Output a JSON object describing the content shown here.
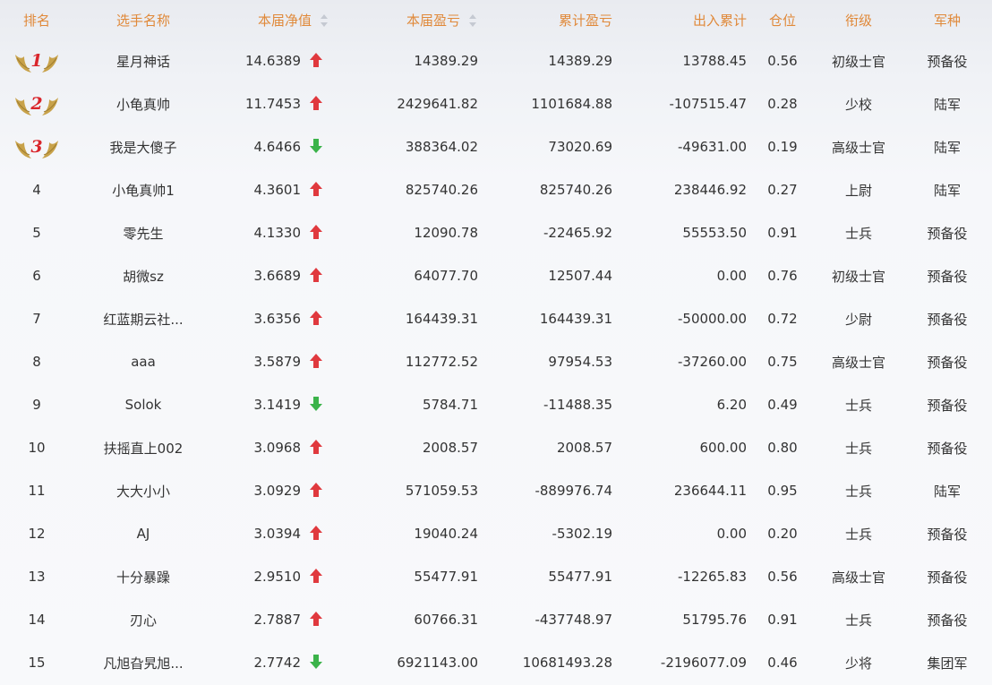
{
  "headers": {
    "rank": "排名",
    "name": "选手名称",
    "net": "本届净值",
    "current_pnl": "本届盈亏",
    "total_pnl": "累计盈亏",
    "inout": "出入累计",
    "position": "仓位",
    "grade": "衔级",
    "arm": "军种"
  },
  "colors": {
    "header": "#e0893a",
    "up": "#e0393e",
    "down": "#3bb34a",
    "medal": "#c8a24a",
    "medal_num": "#d9252b"
  },
  "rows": [
    {
      "rank": "1",
      "medal": true,
      "name": "星月神话",
      "net": "14.6389",
      "trend": "up",
      "cur": "14389.29",
      "tot": "14389.29",
      "io": "13788.45",
      "pos": "0.56",
      "grade": "初级士官",
      "arm": "预备役"
    },
    {
      "rank": "2",
      "medal": true,
      "name": "小龟真帅",
      "net": "11.7453",
      "trend": "up",
      "cur": "2429641.82",
      "tot": "1101684.88",
      "io": "-107515.47",
      "pos": "0.28",
      "grade": "少校",
      "arm": "陆军"
    },
    {
      "rank": "3",
      "medal": true,
      "name": "我是大傻子",
      "net": "4.6466",
      "trend": "down",
      "cur": "388364.02",
      "tot": "73020.69",
      "io": "-49631.00",
      "pos": "0.19",
      "grade": "高级士官",
      "arm": "陆军"
    },
    {
      "rank": "4",
      "medal": false,
      "name": "小龟真帅1",
      "net": "4.3601",
      "trend": "up",
      "cur": "825740.26",
      "tot": "825740.26",
      "io": "238446.92",
      "pos": "0.27",
      "grade": "上尉",
      "arm": "陆军"
    },
    {
      "rank": "5",
      "medal": false,
      "name": "零先生",
      "net": "4.1330",
      "trend": "up",
      "cur": "12090.78",
      "tot": "-22465.92",
      "io": "55553.50",
      "pos": "0.91",
      "grade": "士兵",
      "arm": "预备役"
    },
    {
      "rank": "6",
      "medal": false,
      "name": "胡微sz",
      "net": "3.6689",
      "trend": "up",
      "cur": "64077.70",
      "tot": "12507.44",
      "io": "0.00",
      "pos": "0.76",
      "grade": "初级士官",
      "arm": "预备役"
    },
    {
      "rank": "7",
      "medal": false,
      "name": "红蓝期云社...",
      "net": "3.6356",
      "trend": "up",
      "cur": "164439.31",
      "tot": "164439.31",
      "io": "-50000.00",
      "pos": "0.72",
      "grade": "少尉",
      "arm": "预备役"
    },
    {
      "rank": "8",
      "medal": false,
      "name": "aaa",
      "net": "3.5879",
      "trend": "up",
      "cur": "112772.52",
      "tot": "97954.53",
      "io": "-37260.00",
      "pos": "0.75",
      "grade": "高级士官",
      "arm": "预备役"
    },
    {
      "rank": "9",
      "medal": false,
      "name": "Solok",
      "net": "3.1419",
      "trend": "down",
      "cur": "5784.71",
      "tot": "-11488.35",
      "io": "6.20",
      "pos": "0.49",
      "grade": "士兵",
      "arm": "预备役"
    },
    {
      "rank": "10",
      "medal": false,
      "name": "扶摇直上002",
      "net": "3.0968",
      "trend": "up",
      "cur": "2008.57",
      "tot": "2008.57",
      "io": "600.00",
      "pos": "0.80",
      "grade": "士兵",
      "arm": "预备役"
    },
    {
      "rank": "11",
      "medal": false,
      "name": "大大小小",
      "net": "3.0929",
      "trend": "up",
      "cur": "571059.53",
      "tot": "-889976.74",
      "io": "236644.11",
      "pos": "0.95",
      "grade": "士兵",
      "arm": "陆军"
    },
    {
      "rank": "12",
      "medal": false,
      "name": "AJ",
      "net": "3.0394",
      "trend": "up",
      "cur": "19040.24",
      "tot": "-5302.19",
      "io": "0.00",
      "pos": "0.20",
      "grade": "士兵",
      "arm": "预备役"
    },
    {
      "rank": "13",
      "medal": false,
      "name": "十分暴躁",
      "net": "2.9510",
      "trend": "up",
      "cur": "55477.91",
      "tot": "55477.91",
      "io": "-12265.83",
      "pos": "0.56",
      "grade": "高级士官",
      "arm": "预备役"
    },
    {
      "rank": "14",
      "medal": false,
      "name": "刃心",
      "net": "2.7887",
      "trend": "up",
      "cur": "60766.31",
      "tot": "-437748.97",
      "io": "51795.76",
      "pos": "0.91",
      "grade": "士兵",
      "arm": "预备役"
    },
    {
      "rank": "15",
      "medal": false,
      "name": "凡旭旮旯旭...",
      "net": "2.7742",
      "trend": "down",
      "cur": "6921143.00",
      "tot": "10681493.28",
      "io": "-2196077.09",
      "pos": "0.46",
      "grade": "少将",
      "arm": "集团军"
    }
  ]
}
